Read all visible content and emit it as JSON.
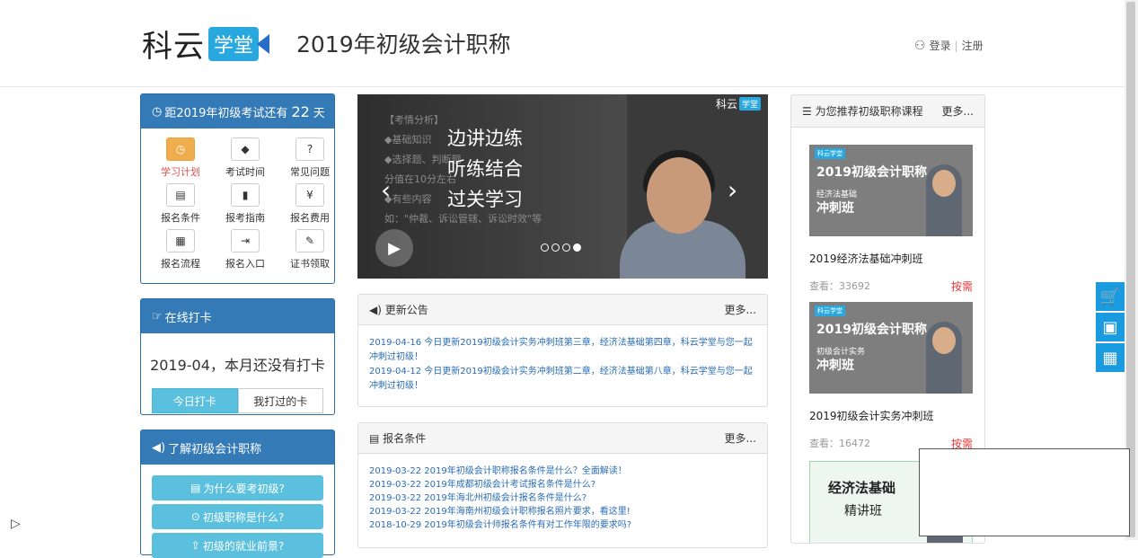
{
  "header": {
    "logo_text": "科云",
    "logo_box": "学堂",
    "title": "2019年初级会计职称",
    "login": "登录",
    "register": "注册"
  },
  "countdown": {
    "prefix": "距2019年初级考试还有",
    "days": "22",
    "suffix": "天",
    "items": [
      {
        "label": "学习计划",
        "icon": "clock-icon",
        "glyph": "◷"
      },
      {
        "label": "考试时间",
        "icon": "tag-icon",
        "glyph": "◆"
      },
      {
        "label": "常见问题",
        "icon": "question-icon",
        "glyph": "?"
      },
      {
        "label": "报名条件",
        "icon": "list-icon",
        "glyph": "▤"
      },
      {
        "label": "报考指南",
        "icon": "book-icon",
        "glyph": "▮"
      },
      {
        "label": "报名费用",
        "icon": "yen-icon",
        "glyph": "¥"
      },
      {
        "label": "报名流程",
        "icon": "grid-icon",
        "glyph": "▦"
      },
      {
        "label": "报名入口",
        "icon": "login-icon",
        "glyph": "⇥"
      },
      {
        "label": "证书领取",
        "icon": "paperclip-icon",
        "glyph": "✎"
      }
    ]
  },
  "checkin": {
    "title": "在线打卡",
    "status": "2019-04，本月还没有打卡",
    "tab_today": "今日打卡",
    "tab_mine": "我打过的卡"
  },
  "learn": {
    "title": "了解初级会计职称",
    "btn1": "为什么要考初级?",
    "btn2": "初级职称是什么?",
    "btn3": "初级的就业前景?"
  },
  "banner": {
    "bg_lines": [
      "【考情分析】",
      "◆基础知识",
      "◆选择题、判断题",
      "分值在10分左右",
      "◆有些内容",
      "如：\"仲裁、诉讼管辖、诉讼时效\"等"
    ],
    "big1": "边讲边练",
    "big2": "听练结合",
    "big3": "过关学习",
    "watermark": "科云",
    "watermark_box": "学堂"
  },
  "updates": {
    "title": "更新公告",
    "more": "更多...",
    "items": [
      "2019-04-16 今日更新2019初级会计实务冲刺班第三章，经济法基础第四章，科云学堂与您一起冲刺过初级！",
      "2019-04-12 今日更新2019初级会计实务冲刺班第二章，经济法基础第八章，科云学堂与您一起冲刺过初级！"
    ]
  },
  "conditions": {
    "title": "报名条件",
    "more": "更多...",
    "items": [
      "2019-03-22 2019年初级会计职称报名条件是什么？全面解读！",
      "2019-03-22 2019年成都初级会计考试报名条件是什么?",
      "2019-03-22 2019年海北州初级会计报名条件是什么?",
      "2019-03-22 2019年海南州初级会计职称报名照片要求，看这里!",
      "2018-10-29 2019年初级会计师报名条件有对工作年限的要求吗?"
    ]
  },
  "recommend": {
    "title": "为您推荐初级职称课程",
    "more": "更多...",
    "courses": [
      {
        "tag": "科云学堂",
        "banner_title": "2019初级会计职称",
        "sub": "经济法基础",
        "big": "冲刺班",
        "name": "2019经济法基础冲刺班",
        "views_label": "查看：",
        "views": "33692",
        "price": "按需"
      },
      {
        "tag": "科云学堂",
        "banner_title": "2019初级会计职称",
        "sub": "初级会计实务",
        "big": "冲刺班",
        "name": "2019初级会计实务冲刺班",
        "views_label": "查看：",
        "views": "16472",
        "price": "按需"
      },
      {
        "tag": "科云学堂",
        "banner_title": "经济法基础",
        "sub": "精讲班",
        "big": "",
        "name": "",
        "views_label": "",
        "views": "",
        "price": ""
      }
    ]
  },
  "sidebar_tools": {
    "cart_count": "0"
  }
}
